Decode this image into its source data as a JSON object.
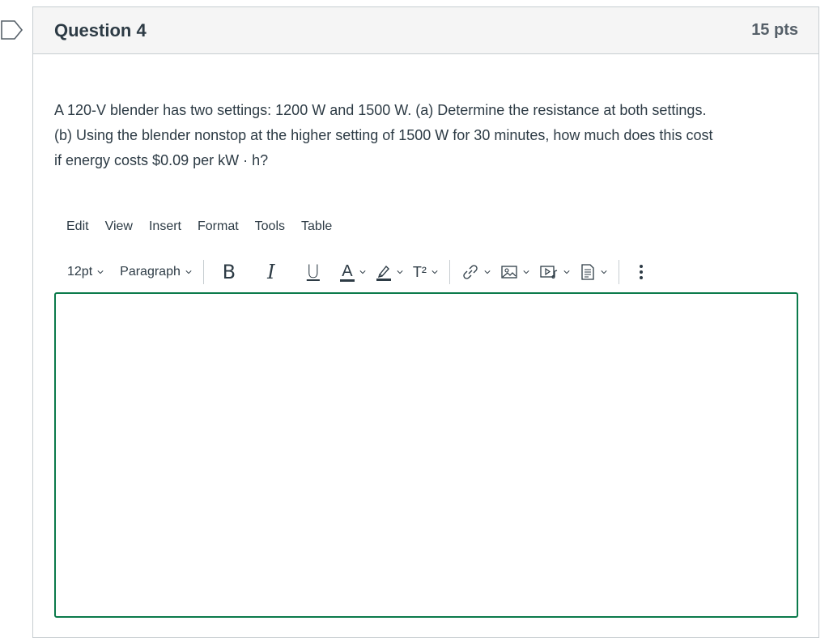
{
  "question": {
    "title": "Question 4",
    "points": "15 pts",
    "text_line1": "A 120-V blender has two settings: 1200 W and 1500 W.  (a) Determine the resistance at both settings.",
    "text_line2": "(b)  Using the blender nonstop at the higher setting of 1500 W for 30 minutes, how much does this cost",
    "text_line3": "if energy costs $0.09 per kW · h?"
  },
  "editor": {
    "menu": [
      "Edit",
      "View",
      "Insert",
      "Format",
      "Tools",
      "Table"
    ],
    "font_size": "12pt",
    "block_format": "Paragraph",
    "bold_label": "B",
    "italic_label": "I",
    "underline_label": "U",
    "text_color_label": "A",
    "superscript_label": "T²",
    "focus_border_color": "#0b7a4b"
  },
  "icons": {
    "flag": "bookmark-flag-icon",
    "link": "link-icon",
    "image": "image-icon",
    "media": "media-icon",
    "document": "document-icon",
    "more": "more-vertical-icon"
  }
}
